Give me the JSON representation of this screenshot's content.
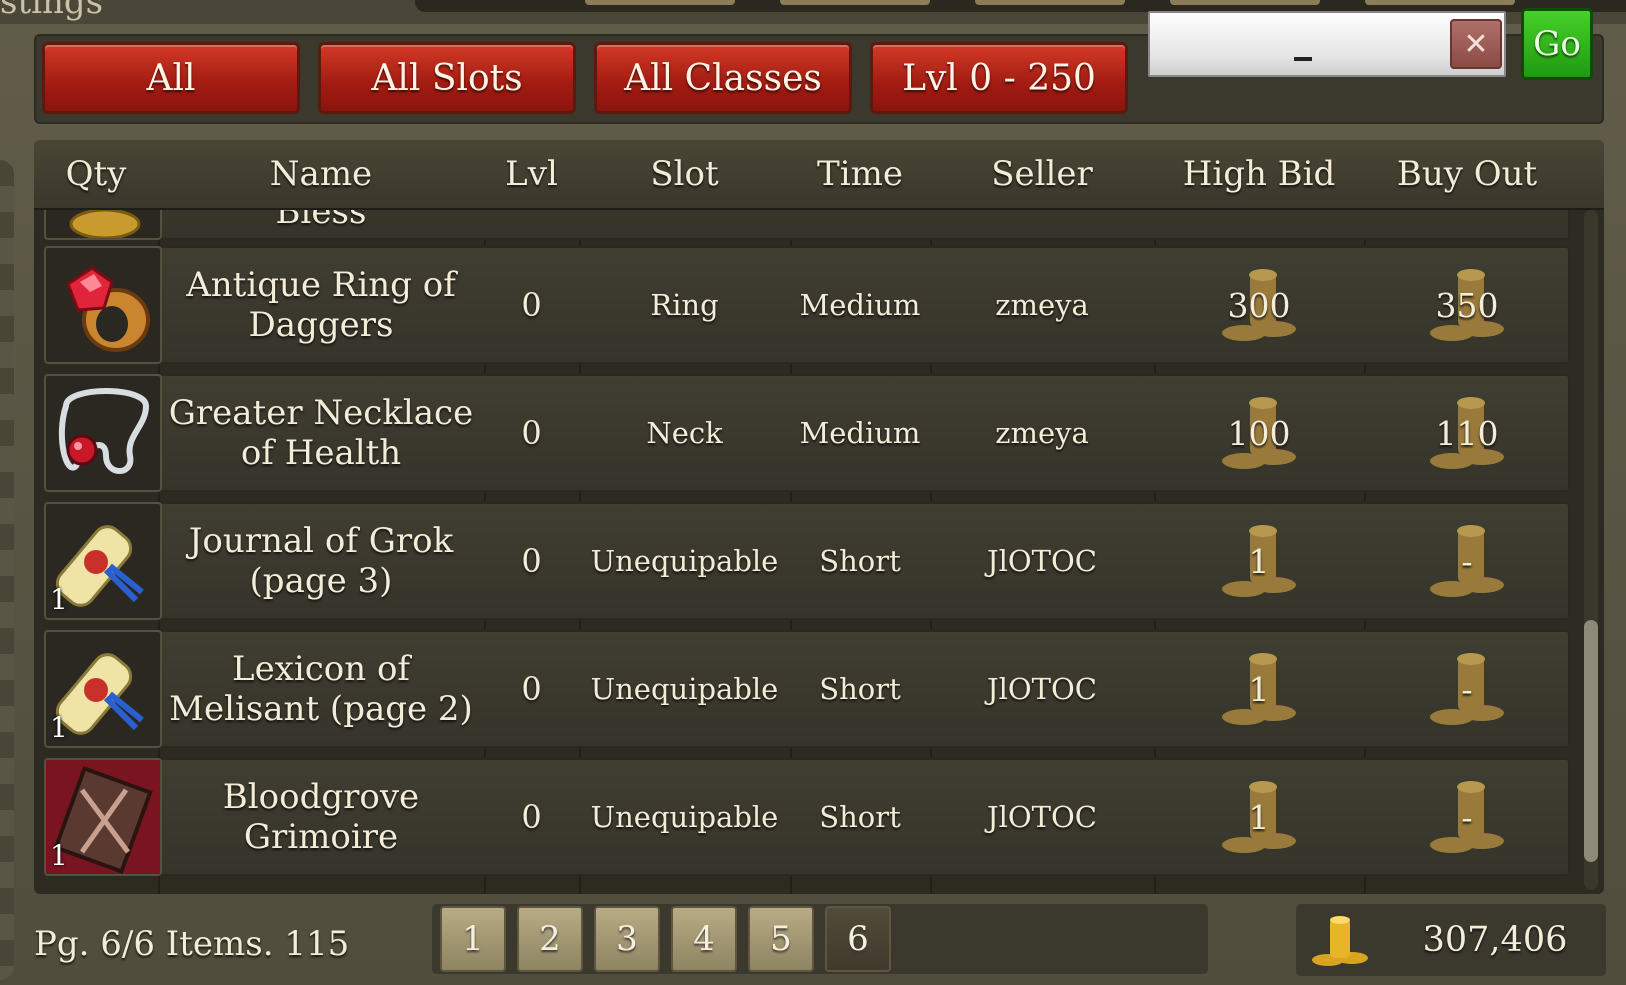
{
  "window": {
    "title_fragment": "stings"
  },
  "filters": {
    "category": "All",
    "slot": "All Slots",
    "class": "All Classes",
    "level_range": "Lvl 0 - 250",
    "search_value": "",
    "clear_label": "✕",
    "go_label": "Go"
  },
  "table": {
    "columns": [
      "Qty",
      "Name",
      "Lvl",
      "Slot",
      "Time",
      "Seller",
      "High Bid",
      "Buy Out"
    ],
    "partial_row": {
      "name_fragment": "Bless"
    },
    "rows": [
      {
        "icon": "ruby-ring-icon",
        "qty": "",
        "name": "Antique Ring of Daggers",
        "lvl": "0",
        "slot": "Ring",
        "time": "Medium",
        "seller": "zmeya",
        "high_bid": "300",
        "buy_out": "350"
      },
      {
        "icon": "red-gem-necklace-icon",
        "qty": "",
        "name": "Greater Necklace of Health",
        "lvl": "0",
        "slot": "Neck",
        "time": "Medium",
        "seller": "zmeya",
        "high_bid": "100",
        "buy_out": "110"
      },
      {
        "icon": "scroll-icon",
        "qty": "1",
        "name": "Journal of Grok (page 3)",
        "lvl": "0",
        "slot": "Unequipable",
        "time": "Short",
        "seller": "JlOTOC",
        "high_bid": "1",
        "buy_out": "-"
      },
      {
        "icon": "scroll-icon",
        "qty": "1",
        "name": "Lexicon of Melisant (page 2)",
        "lvl": "0",
        "slot": "Unequipable",
        "time": "Short",
        "seller": "JlOTOC",
        "high_bid": "1",
        "buy_out": "-"
      },
      {
        "icon": "grimoire-icon",
        "qty": "1",
        "name": "Bloodgrove Grimoire",
        "lvl": "0",
        "slot": "Unequipable",
        "time": "Short",
        "seller": "JlOTOC",
        "high_bid": "1",
        "buy_out": "-"
      }
    ]
  },
  "footer": {
    "page_label": "Pg. 6/6",
    "items_label": "Items. 115",
    "pages": [
      "1",
      "2",
      "3",
      "4",
      "5",
      "6"
    ],
    "active_page": "6",
    "gold": "307,406"
  },
  "colors": {
    "red_button": "#b72416",
    "go_green": "#2fb51a",
    "panel": "#2c2a21"
  }
}
